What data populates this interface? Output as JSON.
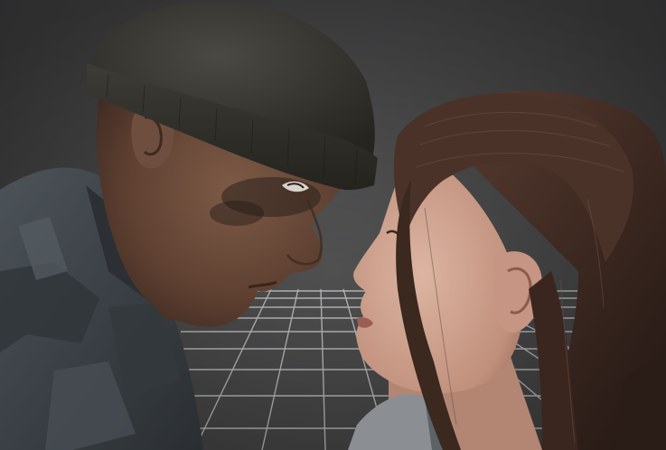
{
  "scene": {
    "subjects": [
      "man-figure",
      "woman-figure"
    ],
    "background": "3d-viewport-grid"
  },
  "colors": {
    "background": "#4b4b4c",
    "grid_line": "#c9c9c9",
    "man_skin": "#6a4a3a",
    "man_beanie": "#35342f",
    "man_jacket": "#3e4449",
    "woman_skin": "#c99f8c",
    "woman_hair": "#4a3229"
  }
}
